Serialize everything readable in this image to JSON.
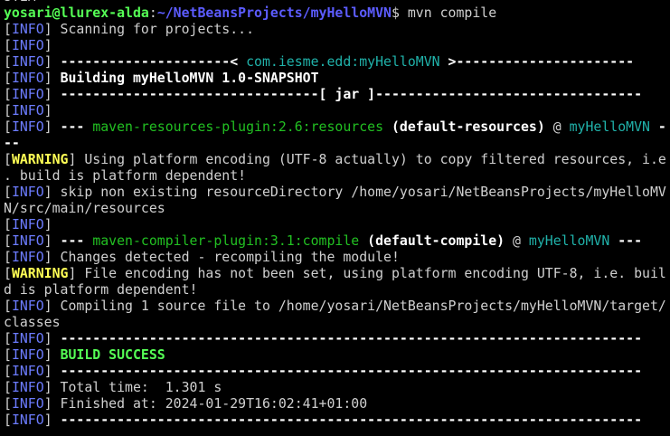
{
  "colors": {
    "background": "#000000",
    "text": "#d0d0d0",
    "info_tag": "#6c7cff",
    "warning_tag": "#ffff55",
    "success": "#55ff55",
    "prompt_user": "#55ff55",
    "prompt_path": "#5c5cff",
    "artifact": "#20b2aa",
    "plugin": "#22c022"
  },
  "lines": [
    {
      "name": "terminal-line-0",
      "segments": [
        {
          "t": "sTEM",
          "c": "plain"
        }
      ]
    },
    {
      "name": "prompt-line",
      "segments": [
        {
          "t": "yosari@llurex-alda",
          "c": "prompt-user"
        },
        {
          "t": ":",
          "c": "plain"
        },
        {
          "t": "~/NetBeansProjects/myHelloMVN",
          "c": "prompt-path"
        },
        {
          "t": "$ mvn compile",
          "c": "plain"
        }
      ]
    },
    {
      "name": "terminal-line-2",
      "segments": [
        {
          "t": "[",
          "c": "bracket"
        },
        {
          "t": "INFO",
          "c": "tag-info"
        },
        {
          "t": "] Scanning for projects...",
          "c": "plain"
        }
      ]
    },
    {
      "name": "terminal-line-3",
      "segments": [
        {
          "t": "[",
          "c": "bracket"
        },
        {
          "t": "INFO",
          "c": "tag-info"
        },
        {
          "t": "]",
          "c": "plain"
        }
      ]
    },
    {
      "name": "terminal-line-4",
      "segments": [
        {
          "t": "[",
          "c": "bracket"
        },
        {
          "t": "INFO",
          "c": "tag-info"
        },
        {
          "t": "] ",
          "c": "plain"
        },
        {
          "t": "---------------------< ",
          "c": "white-b"
        },
        {
          "t": "com.iesme.edd:myHelloMVN",
          "c": "cyan"
        },
        {
          "t": " >----------------------",
          "c": "white-b"
        }
      ]
    },
    {
      "name": "terminal-line-5",
      "segments": [
        {
          "t": "[",
          "c": "bracket"
        },
        {
          "t": "INFO",
          "c": "tag-info"
        },
        {
          "t": "] ",
          "c": "plain"
        },
        {
          "t": "Building myHelloMVN 1.0-SNAPSHOT",
          "c": "white-b"
        }
      ]
    },
    {
      "name": "terminal-line-6",
      "segments": [
        {
          "t": "[",
          "c": "bracket"
        },
        {
          "t": "INFO",
          "c": "tag-info"
        },
        {
          "t": "] ",
          "c": "plain"
        },
        {
          "t": "--------------------------------[ jar ]---------------------------------",
          "c": "white-b"
        }
      ]
    },
    {
      "name": "terminal-line-7",
      "segments": [
        {
          "t": "[",
          "c": "bracket"
        },
        {
          "t": "INFO",
          "c": "tag-info"
        },
        {
          "t": "]",
          "c": "plain"
        }
      ]
    },
    {
      "name": "terminal-line-8",
      "segments": [
        {
          "t": "[",
          "c": "bracket"
        },
        {
          "t": "INFO",
          "c": "tag-info"
        },
        {
          "t": "] ",
          "c": "plain"
        },
        {
          "t": "--- ",
          "c": "white-b"
        },
        {
          "t": "maven-resources-plugin:2.6:resources",
          "c": "mgreen"
        },
        {
          "t": " (default-resources)",
          "c": "white-b"
        },
        {
          "t": " @ ",
          "c": "plain"
        },
        {
          "t": "myHelloMVN",
          "c": "cyan"
        },
        {
          "t": " -",
          "c": "white-b"
        }
      ]
    },
    {
      "name": "terminal-line-9",
      "segments": [
        {
          "t": "--",
          "c": "white-b"
        }
      ]
    },
    {
      "name": "terminal-line-10",
      "segments": [
        {
          "t": "[",
          "c": "bracket"
        },
        {
          "t": "WARNING",
          "c": "tag-warn"
        },
        {
          "t": "] Using platform encoding (UTF-8 actually) to copy filtered resources, i.e",
          "c": "plain"
        }
      ]
    },
    {
      "name": "terminal-line-11",
      "segments": [
        {
          "t": ". build is platform dependent!",
          "c": "plain"
        }
      ]
    },
    {
      "name": "terminal-line-12",
      "segments": [
        {
          "t": "[",
          "c": "bracket"
        },
        {
          "t": "INFO",
          "c": "tag-info"
        },
        {
          "t": "] skip non existing resourceDirectory /home/yosari/NetBeansProjects/myHelloMV",
          "c": "plain"
        }
      ]
    },
    {
      "name": "terminal-line-13",
      "segments": [
        {
          "t": "N/src/main/resources",
          "c": "plain"
        }
      ]
    },
    {
      "name": "terminal-line-14",
      "segments": [
        {
          "t": "[",
          "c": "bracket"
        },
        {
          "t": "INFO",
          "c": "tag-info"
        },
        {
          "t": "]",
          "c": "plain"
        }
      ]
    },
    {
      "name": "terminal-line-15",
      "segments": [
        {
          "t": "[",
          "c": "bracket"
        },
        {
          "t": "INFO",
          "c": "tag-info"
        },
        {
          "t": "] ",
          "c": "plain"
        },
        {
          "t": "--- ",
          "c": "white-b"
        },
        {
          "t": "maven-compiler-plugin:3.1:compile",
          "c": "mgreen"
        },
        {
          "t": " (default-compile)",
          "c": "white-b"
        },
        {
          "t": " @ ",
          "c": "plain"
        },
        {
          "t": "myHelloMVN",
          "c": "cyan"
        },
        {
          "t": " ---",
          "c": "white-b"
        }
      ]
    },
    {
      "name": "terminal-line-16",
      "segments": [
        {
          "t": "[",
          "c": "bracket"
        },
        {
          "t": "INFO",
          "c": "tag-info"
        },
        {
          "t": "] Changes detected - recompiling the module!",
          "c": "plain"
        }
      ]
    },
    {
      "name": "terminal-line-17",
      "segments": [
        {
          "t": "[",
          "c": "bracket"
        },
        {
          "t": "WARNING",
          "c": "tag-warn"
        },
        {
          "t": "] File encoding has not been set, using platform encoding UTF-8, i.e. buil",
          "c": "plain"
        }
      ]
    },
    {
      "name": "terminal-line-18",
      "segments": [
        {
          "t": "d is platform dependent!",
          "c": "plain"
        }
      ]
    },
    {
      "name": "terminal-line-19",
      "segments": [
        {
          "t": "[",
          "c": "bracket"
        },
        {
          "t": "INFO",
          "c": "tag-info"
        },
        {
          "t": "] Compiling 1 source file to /home/yosari/NetBeansProjects/myHelloMVN/target/",
          "c": "plain"
        }
      ]
    },
    {
      "name": "terminal-line-20",
      "segments": [
        {
          "t": "classes",
          "c": "plain"
        }
      ]
    },
    {
      "name": "terminal-line-21",
      "segments": [
        {
          "t": "[",
          "c": "bracket"
        },
        {
          "t": "INFO",
          "c": "tag-info"
        },
        {
          "t": "] ",
          "c": "plain"
        },
        {
          "t": "------------------------------------------------------------------------",
          "c": "white-b"
        }
      ]
    },
    {
      "name": "terminal-line-22",
      "segments": [
        {
          "t": "[",
          "c": "bracket"
        },
        {
          "t": "INFO",
          "c": "tag-info"
        },
        {
          "t": "] ",
          "c": "plain"
        },
        {
          "t": "BUILD SUCCESS",
          "c": "green b"
        }
      ]
    },
    {
      "name": "terminal-line-23",
      "segments": [
        {
          "t": "[",
          "c": "bracket"
        },
        {
          "t": "INFO",
          "c": "tag-info"
        },
        {
          "t": "] ",
          "c": "plain"
        },
        {
          "t": "------------------------------------------------------------------------",
          "c": "white-b"
        }
      ]
    },
    {
      "name": "terminal-line-24",
      "segments": [
        {
          "t": "[",
          "c": "bracket"
        },
        {
          "t": "INFO",
          "c": "tag-info"
        },
        {
          "t": "] Total time:  1.301 s",
          "c": "plain"
        }
      ]
    },
    {
      "name": "terminal-line-25",
      "segments": [
        {
          "t": "[",
          "c": "bracket"
        },
        {
          "t": "INFO",
          "c": "tag-info"
        },
        {
          "t": "] Finished at: 2024-01-29T16:02:41+01:00",
          "c": "plain"
        }
      ]
    },
    {
      "name": "terminal-line-26",
      "segments": [
        {
          "t": "[",
          "c": "bracket"
        },
        {
          "t": "INFO",
          "c": "tag-info"
        },
        {
          "t": "] ",
          "c": "plain"
        },
        {
          "t": "------------------------------------------------------------------------",
          "c": "white-b"
        }
      ]
    }
  ]
}
